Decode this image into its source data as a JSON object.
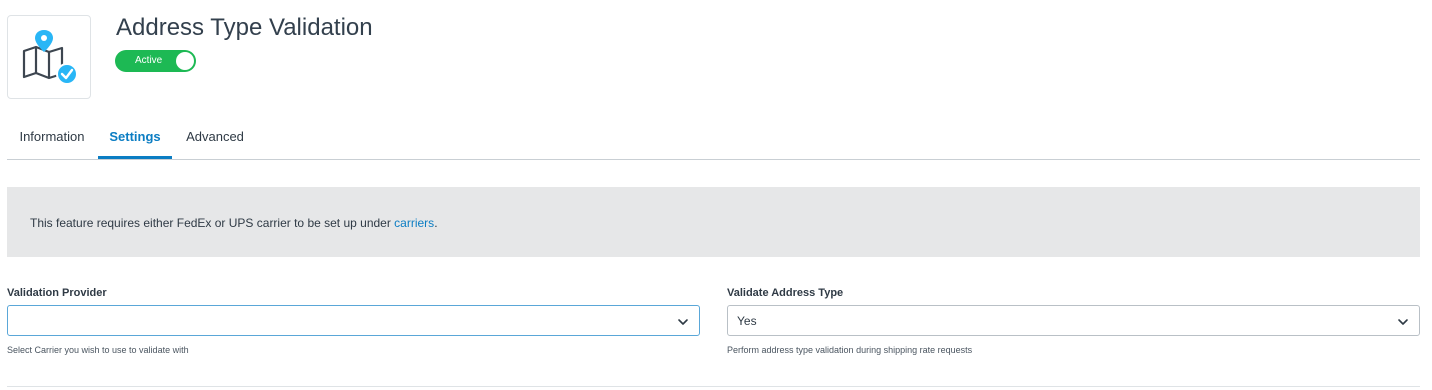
{
  "app": {
    "title": "Address Type Validation",
    "status_label": "Active",
    "status_color": "#1db954",
    "icon": "map-location-check-icon"
  },
  "tabs": [
    {
      "label": "Information",
      "active": false
    },
    {
      "label": "Settings",
      "active": true
    },
    {
      "label": "Advanced",
      "active": false
    }
  ],
  "notice": {
    "text": "This feature requires either FedEx or UPS carrier to be set up under ",
    "link_text": "carriers",
    "suffix": "."
  },
  "fields": {
    "provider": {
      "label": "Validation Provider",
      "value": "",
      "help": "Select Carrier you wish to use to validate with"
    },
    "address_type": {
      "label": "Validate Address Type",
      "value": "Yes",
      "help": "Perform address type validation during shipping rate requests"
    }
  },
  "colors": {
    "accent": "#0b7dc3",
    "focus_border": "#5aa7d8",
    "icon_badge": "#29b6f6"
  }
}
